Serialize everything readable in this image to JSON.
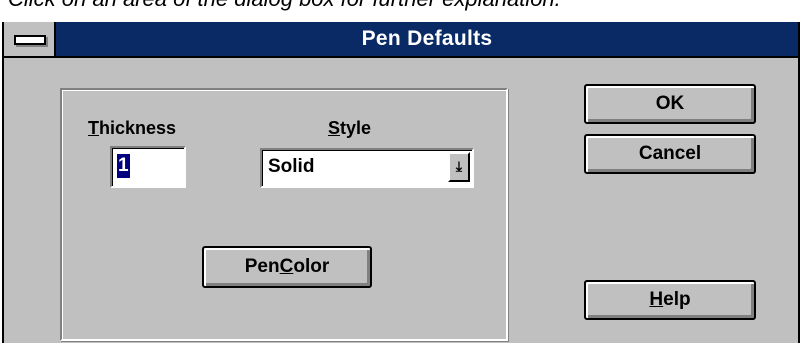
{
  "page": {
    "caption": "Click on an area of the dialog box for further explanation."
  },
  "dialog": {
    "title": "Pen Defaults",
    "thickness": {
      "label_mnemonic": "T",
      "label_rest": "hickness",
      "value": "1"
    },
    "style": {
      "label_mnemonic": "S",
      "label_rest": "tyle",
      "selected": "Solid",
      "dropdown_glyph": "⤓"
    },
    "pen_color_button": {
      "label_before": "Pen ",
      "label_mnemonic": "C",
      "label_after": "olor"
    },
    "ok_button": {
      "label": "OK"
    },
    "cancel_button": {
      "label": "Cancel"
    },
    "help_button": {
      "label_mnemonic": "H",
      "label_rest": "elp"
    }
  },
  "colors": {
    "titlebar": "#0a2a66",
    "dialog_face": "#c0c0c0",
    "selection": "#000080"
  }
}
